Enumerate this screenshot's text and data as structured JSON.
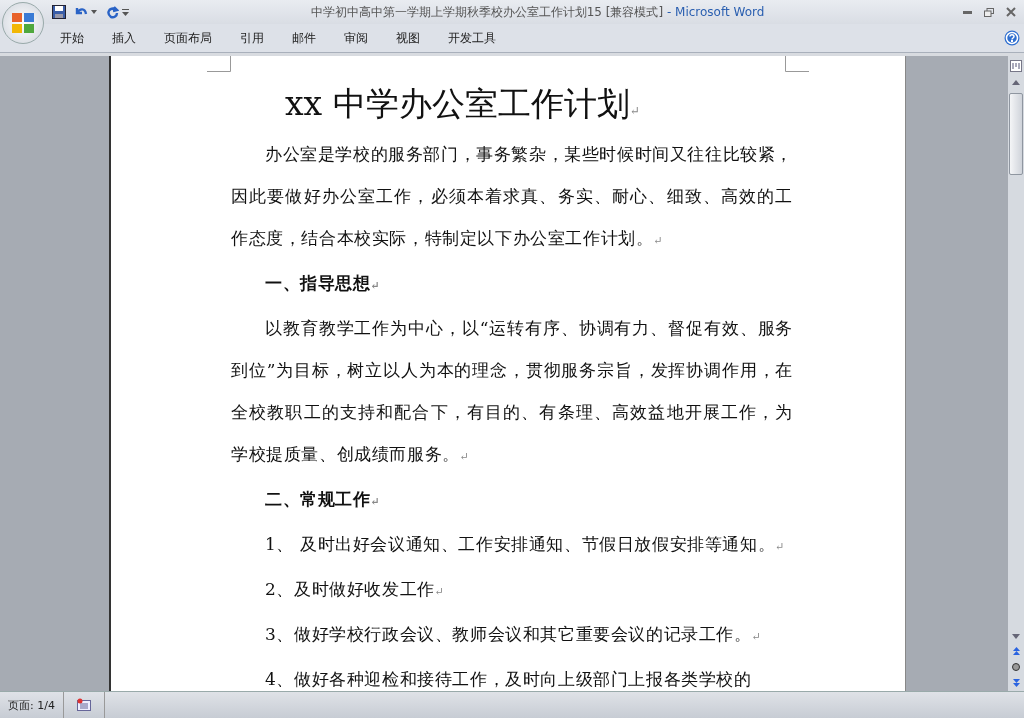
{
  "window": {
    "title": "中学初中高中第一学期上学期秋季校办公室工作计划15 [兼容模式]",
    "app_name": "- Microsoft Word"
  },
  "ribbon_tabs": [
    {
      "label": "开始"
    },
    {
      "label": "插入"
    },
    {
      "label": "页面布局"
    },
    {
      "label": "引用"
    },
    {
      "label": "邮件"
    },
    {
      "label": "审阅"
    },
    {
      "label": "视图"
    },
    {
      "label": "开发工具"
    }
  ],
  "document": {
    "title": "xx 中学办公室工作计划",
    "title_end_mark": "↵",
    "paragraphs": [
      {
        "kind": "body",
        "text": "办公室是学校的服务部门，事务繁杂，某些时候时间又往往比较紧，因此要做好办公室工作，必须本着求真、务实、耐心、细致、高效的工作态度，结合本校实际，特制定以下办公室工作计划。",
        "end_mark": "↵"
      },
      {
        "kind": "heading",
        "text": "一、指导思想",
        "end_mark": "↵"
      },
      {
        "kind": "body",
        "text": "以教育教学工作为中心，以“运转有序、协调有力、督促有效、服务到位”为目标，树立以人为本的理念，贯彻服务宗旨，发挥协调作用，在全校教职工的支持和配合下，有目的、有条理、高效益地开展工作，为学校提质量、创成绩而服务。",
        "end_mark": "↵"
      },
      {
        "kind": "heading",
        "text": "二、常规工作",
        "end_mark": "↵"
      },
      {
        "kind": "body",
        "text": "1、 及时出好会议通知、工作安排通知、节假日放假安排等通知。",
        "end_mark": "↵"
      },
      {
        "kind": "body",
        "text": "2、及时做好收发工作",
        "end_mark": "↵"
      },
      {
        "kind": "body",
        "text": "3、做好学校行政会议、教师会议和其它重要会议的记录工作。",
        "end_mark": "↵"
      },
      {
        "kind": "body",
        "text": "4、做好各种迎检和接待工作，及时向上级部门上报各类学校的"
      }
    ]
  },
  "status_bar": {
    "page": "页面: 1/4"
  }
}
